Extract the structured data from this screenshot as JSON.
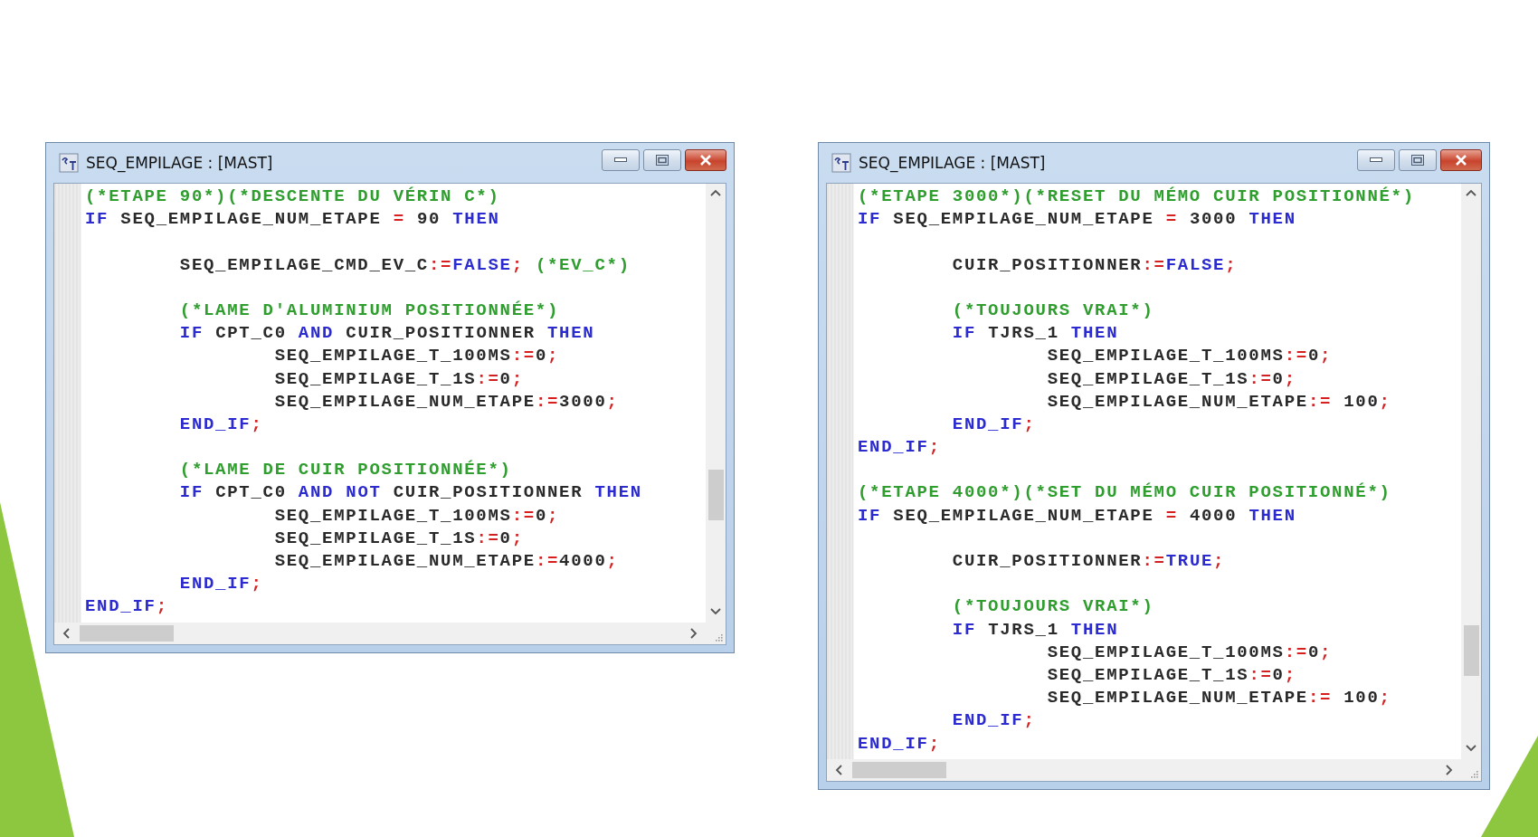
{
  "windows": [
    {
      "title": "SEQ_EMPILAGE : [MAST]",
      "lines": [
        {
          "kind": "code",
          "tokens": [
            {
              "kind": "comment",
              "text": "(*ETAPE 90*)(*DESCENTE DU VÉRIN C*)"
            }
          ]
        },
        {
          "kind": "code",
          "tokens": [
            {
              "kind": "keyword",
              "text": "IF"
            },
            {
              "kind": "identifier",
              "text": " SEQ_EMPILAGE_NUM_ETAPE "
            },
            {
              "kind": "operator",
              "text": "="
            },
            {
              "kind": "number",
              "text": " 90 "
            },
            {
              "kind": "keyword",
              "text": "THEN"
            }
          ]
        },
        {
          "kind": "blank"
        },
        {
          "kind": "code",
          "tokens": [
            {
              "kind": "identifier",
              "text": "        SEQ_EMPILAGE_CMD_EV_C"
            },
            {
              "kind": "operator",
              "text": ":="
            },
            {
              "kind": "keyword",
              "text": "FALSE"
            },
            {
              "kind": "operator",
              "text": ";"
            },
            {
              "kind": "comment",
              "text": " (*EV_C*)"
            }
          ]
        },
        {
          "kind": "blank"
        },
        {
          "kind": "code",
          "tokens": [
            {
              "kind": "comment",
              "text": "        (*LAME D'ALUMINIUM POSITIONNÉE*)"
            }
          ]
        },
        {
          "kind": "code",
          "tokens": [
            {
              "kind": "keyword",
              "text": "        IF"
            },
            {
              "kind": "identifier",
              "text": " CPT_C0 "
            },
            {
              "kind": "keyword",
              "text": "AND"
            },
            {
              "kind": "identifier",
              "text": " CUIR_POSITIONNER "
            },
            {
              "kind": "keyword",
              "text": "THEN"
            }
          ]
        },
        {
          "kind": "code",
          "tokens": [
            {
              "kind": "identifier",
              "text": "                SEQ_EMPILAGE_T_100MS"
            },
            {
              "kind": "operator",
              "text": ":="
            },
            {
              "kind": "number",
              "text": "0"
            },
            {
              "kind": "operator",
              "text": ";"
            }
          ]
        },
        {
          "kind": "code",
          "tokens": [
            {
              "kind": "identifier",
              "text": "                SEQ_EMPILAGE_T_1S"
            },
            {
              "kind": "operator",
              "text": ":="
            },
            {
              "kind": "number",
              "text": "0"
            },
            {
              "kind": "operator",
              "text": ";"
            }
          ]
        },
        {
          "kind": "code",
          "tokens": [
            {
              "kind": "identifier",
              "text": "                SEQ_EMPILAGE_NUM_ETAPE"
            },
            {
              "kind": "operator",
              "text": ":="
            },
            {
              "kind": "number",
              "text": "3000"
            },
            {
              "kind": "operator",
              "text": ";"
            }
          ]
        },
        {
          "kind": "code",
          "tokens": [
            {
              "kind": "keyword",
              "text": "        END_IF"
            },
            {
              "kind": "operator",
              "text": ";"
            }
          ]
        },
        {
          "kind": "blank"
        },
        {
          "kind": "code",
          "tokens": [
            {
              "kind": "comment",
              "text": "        (*LAME DE CUIR POSITIONNÉE*)"
            }
          ]
        },
        {
          "kind": "code",
          "tokens": [
            {
              "kind": "keyword",
              "text": "        IF"
            },
            {
              "kind": "identifier",
              "text": " CPT_C0 "
            },
            {
              "kind": "keyword",
              "text": "AND"
            },
            {
              "kind": "keyword",
              "text": " NOT"
            },
            {
              "kind": "identifier",
              "text": " CUIR_POSITIONNER "
            },
            {
              "kind": "keyword",
              "text": "THEN"
            }
          ]
        },
        {
          "kind": "code",
          "tokens": [
            {
              "kind": "identifier",
              "text": "                SEQ_EMPILAGE_T_100MS"
            },
            {
              "kind": "operator",
              "text": ":="
            },
            {
              "kind": "number",
              "text": "0"
            },
            {
              "kind": "operator",
              "text": ";"
            }
          ]
        },
        {
          "kind": "code",
          "tokens": [
            {
              "kind": "identifier",
              "text": "                SEQ_EMPILAGE_T_1S"
            },
            {
              "kind": "operator",
              "text": ":="
            },
            {
              "kind": "number",
              "text": "0"
            },
            {
              "kind": "operator",
              "text": ";"
            }
          ]
        },
        {
          "kind": "code",
          "tokens": [
            {
              "kind": "identifier",
              "text": "                SEQ_EMPILAGE_NUM_ETAPE"
            },
            {
              "kind": "operator",
              "text": ":="
            },
            {
              "kind": "number",
              "text": "4000"
            },
            {
              "kind": "operator",
              "text": ";"
            }
          ]
        },
        {
          "kind": "code",
          "tokens": [
            {
              "kind": "keyword",
              "text": "        END_IF"
            },
            {
              "kind": "operator",
              "text": ";"
            }
          ]
        },
        {
          "kind": "code",
          "tokens": [
            {
              "kind": "keyword",
              "text": "END_IF"
            },
            {
              "kind": "operator",
              "text": ";"
            }
          ]
        }
      ]
    },
    {
      "title": "SEQ_EMPILAGE : [MAST]",
      "lines": [
        {
          "kind": "code",
          "tokens": [
            {
              "kind": "comment",
              "text": "(*ETAPE 3000*)(*RESET DU MÉMO CUIR POSITIONNÉ*)"
            }
          ]
        },
        {
          "kind": "code",
          "tokens": [
            {
              "kind": "keyword",
              "text": "IF"
            },
            {
              "kind": "identifier",
              "text": " SEQ_EMPILAGE_NUM_ETAPE "
            },
            {
              "kind": "operator",
              "text": "="
            },
            {
              "kind": "number",
              "text": " 3000 "
            },
            {
              "kind": "keyword",
              "text": "THEN"
            }
          ]
        },
        {
          "kind": "blank"
        },
        {
          "kind": "code",
          "tokens": [
            {
              "kind": "identifier",
              "text": "        CUIR_POSITIONNER"
            },
            {
              "kind": "operator",
              "text": ":="
            },
            {
              "kind": "keyword",
              "text": "FALSE"
            },
            {
              "kind": "operator",
              "text": ";"
            }
          ]
        },
        {
          "kind": "blank"
        },
        {
          "kind": "code",
          "tokens": [
            {
              "kind": "comment",
              "text": "        (*TOUJOURS VRAI*)"
            }
          ]
        },
        {
          "kind": "code",
          "tokens": [
            {
              "kind": "keyword",
              "text": "        IF"
            },
            {
              "kind": "identifier",
              "text": " TJRS_1 "
            },
            {
              "kind": "keyword",
              "text": "THEN"
            }
          ]
        },
        {
          "kind": "code",
          "tokens": [
            {
              "kind": "identifier",
              "text": "                SEQ_EMPILAGE_T_100MS"
            },
            {
              "kind": "operator",
              "text": ":="
            },
            {
              "kind": "number",
              "text": "0"
            },
            {
              "kind": "operator",
              "text": ";"
            }
          ]
        },
        {
          "kind": "code",
          "tokens": [
            {
              "kind": "identifier",
              "text": "                SEQ_EMPILAGE_T_1S"
            },
            {
              "kind": "operator",
              "text": ":="
            },
            {
              "kind": "number",
              "text": "0"
            },
            {
              "kind": "operator",
              "text": ";"
            }
          ]
        },
        {
          "kind": "code",
          "tokens": [
            {
              "kind": "identifier",
              "text": "                SEQ_EMPILAGE_NUM_ETAPE"
            },
            {
              "kind": "operator",
              "text": ":="
            },
            {
              "kind": "number",
              "text": " 100"
            },
            {
              "kind": "operator",
              "text": ";"
            }
          ]
        },
        {
          "kind": "code",
          "tokens": [
            {
              "kind": "keyword",
              "text": "        END_IF"
            },
            {
              "kind": "operator",
              "text": ";"
            }
          ]
        },
        {
          "kind": "code",
          "tokens": [
            {
              "kind": "keyword",
              "text": "END_IF"
            },
            {
              "kind": "operator",
              "text": ";"
            }
          ]
        },
        {
          "kind": "blank"
        },
        {
          "kind": "code",
          "tokens": [
            {
              "kind": "comment",
              "text": "(*ETAPE 4000*)(*SET DU MÉMO CUIR POSITIONNÉ*)"
            }
          ]
        },
        {
          "kind": "code",
          "tokens": [
            {
              "kind": "keyword",
              "text": "IF"
            },
            {
              "kind": "identifier",
              "text": " SEQ_EMPILAGE_NUM_ETAPE "
            },
            {
              "kind": "operator",
              "text": "="
            },
            {
              "kind": "number",
              "text": " 4000 "
            },
            {
              "kind": "keyword",
              "text": "THEN"
            }
          ]
        },
        {
          "kind": "blank"
        },
        {
          "kind": "code",
          "tokens": [
            {
              "kind": "identifier",
              "text": "        CUIR_POSITIONNER"
            },
            {
              "kind": "operator",
              "text": ":="
            },
            {
              "kind": "keyword",
              "text": "TRUE"
            },
            {
              "kind": "operator",
              "text": ";"
            }
          ]
        },
        {
          "kind": "blank"
        },
        {
          "kind": "code",
          "tokens": [
            {
              "kind": "comment",
              "text": "        (*TOUJOURS VRAI*)"
            }
          ]
        },
        {
          "kind": "code",
          "tokens": [
            {
              "kind": "keyword",
              "text": "        IF"
            },
            {
              "kind": "identifier",
              "text": " TJRS_1 "
            },
            {
              "kind": "keyword",
              "text": "THEN"
            }
          ]
        },
        {
          "kind": "code",
          "tokens": [
            {
              "kind": "identifier",
              "text": "                SEQ_EMPILAGE_T_100MS"
            },
            {
              "kind": "operator",
              "text": ":="
            },
            {
              "kind": "number",
              "text": "0"
            },
            {
              "kind": "operator",
              "text": ";"
            }
          ]
        },
        {
          "kind": "code",
          "tokens": [
            {
              "kind": "identifier",
              "text": "                SEQ_EMPILAGE_T_1S"
            },
            {
              "kind": "operator",
              "text": ":="
            },
            {
              "kind": "number",
              "text": "0"
            },
            {
              "kind": "operator",
              "text": ";"
            }
          ]
        },
        {
          "kind": "code",
          "tokens": [
            {
              "kind": "identifier",
              "text": "                SEQ_EMPILAGE_NUM_ETAPE"
            },
            {
              "kind": "operator",
              "text": ":="
            },
            {
              "kind": "number",
              "text": " 100"
            },
            {
              "kind": "operator",
              "text": ";"
            }
          ]
        },
        {
          "kind": "code",
          "tokens": [
            {
              "kind": "keyword",
              "text": "        END_IF"
            },
            {
              "kind": "operator",
              "text": ";"
            }
          ]
        },
        {
          "kind": "code",
          "tokens": [
            {
              "kind": "keyword",
              "text": "END_IF"
            },
            {
              "kind": "operator",
              "text": ";"
            }
          ]
        }
      ]
    }
  ]
}
